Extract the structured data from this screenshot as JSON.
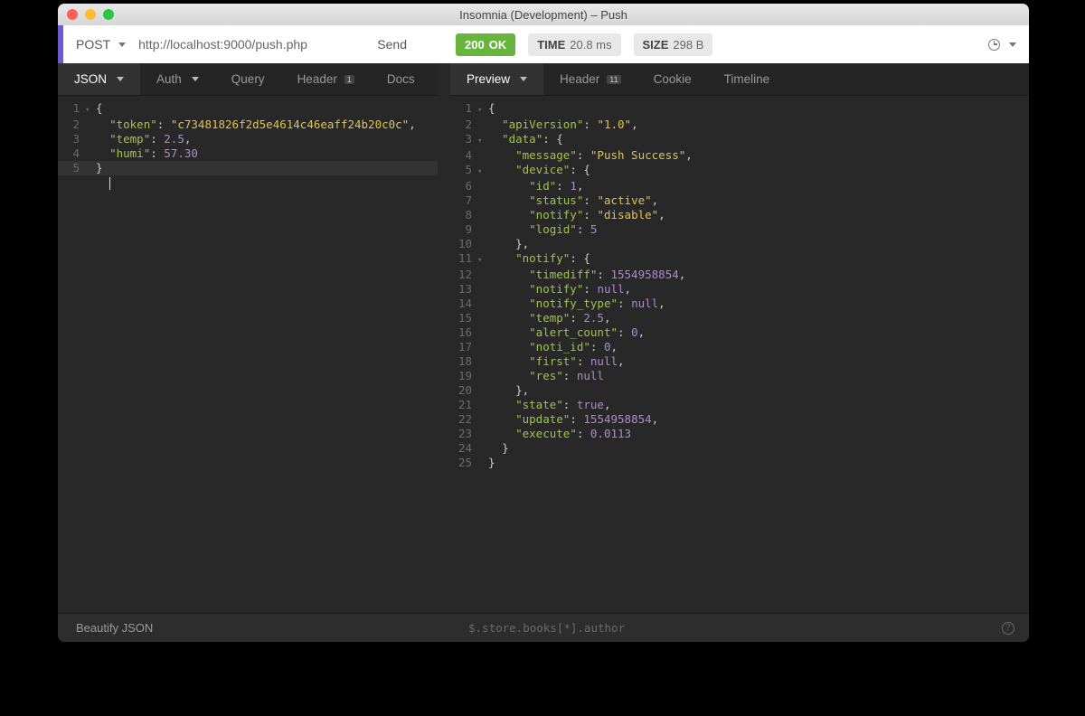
{
  "window": {
    "title": "Insomnia (Development) – Push"
  },
  "request": {
    "method": "POST",
    "url": "http://localhost:9000/push.php",
    "send": "Send"
  },
  "response": {
    "status_code": "200",
    "status_text": "OK",
    "time_label": "TIME",
    "time_value": "20.8 ms",
    "size_label": "SIZE",
    "size_value": "298 B"
  },
  "tabs_left": {
    "json": "JSON",
    "auth": "Auth",
    "query": "Query",
    "header": "Header",
    "header_badge": "1",
    "docs": "Docs"
  },
  "tabs_right": {
    "preview": "Preview",
    "header": "Header",
    "header_badge": "11",
    "cookie": "Cookie",
    "timeline": "Timeline"
  },
  "body_left": {
    "l1": "{",
    "l2a": "\"token\"",
    "l2b": ": ",
    "l2c": "\"c73481826f2d5e4614c46eaff24b20c0c\"",
    "l2d": ",",
    "l3a": "\"temp\"",
    "l3b": ": ",
    "l3c": "2.5",
    "l3d": ",",
    "l4a": "\"humi\"",
    "l4b": ": ",
    "l4c": "57.30",
    "l5": "}"
  },
  "body_right": {
    "l1": "{",
    "l2a": "\"apiVersion\"",
    "l2v": "\"1.0\"",
    "l3a": "\"data\"",
    "l4a": "\"message\"",
    "l4v": "\"Push Success\"",
    "l5a": "\"device\"",
    "l6a": "\"id\"",
    "l6v": "1",
    "l7a": "\"status\"",
    "l7v": "\"active\"",
    "l8a": "\"notify\"",
    "l8v": "\"disable\"",
    "l9a": "\"logid\"",
    "l9v": "5",
    "l11a": "\"notify\"",
    "l12a": "\"timediff\"",
    "l12v": "1554958854",
    "l13a": "\"notify\"",
    "l13v": "null",
    "l14a": "\"notify_type\"",
    "l14v": "null",
    "l15a": "\"temp\"",
    "l15v": "2.5",
    "l16a": "\"alert_count\"",
    "l16v": "0",
    "l17a": "\"noti_id\"",
    "l17v": "0",
    "l18a": "\"first\"",
    "l18v": "null",
    "l19a": "\"res\"",
    "l19v": "null",
    "l21a": "\"state\"",
    "l21v": "true",
    "l22a": "\"update\"",
    "l22v": "1554958854",
    "l23a": "\"execute\"",
    "l23v": "0.0113"
  },
  "footer": {
    "beautify": "Beautify JSON",
    "jsonpath": "$.store.books[*].author"
  }
}
